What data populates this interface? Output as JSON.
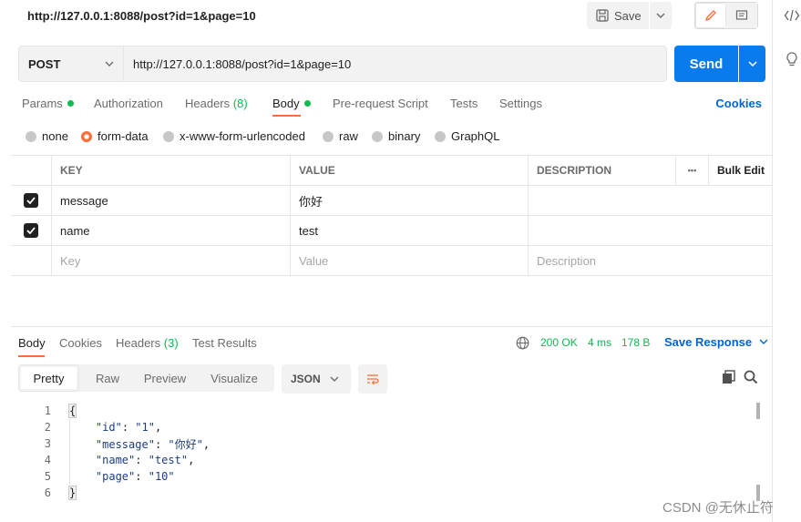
{
  "titlebar": {
    "tab_title": "http://127.0.0.1:8088/post?id=1&page=10",
    "save_label": "Save"
  },
  "request": {
    "method": "POST",
    "url": "http://127.0.0.1:8088/post?id=1&page=10",
    "send_label": "Send"
  },
  "request_tabs": {
    "params": "Params",
    "authorization": "Authorization",
    "headers": "Headers",
    "headers_count": "(8)",
    "body": "Body",
    "pre_request": "Pre-request Script",
    "tests": "Tests",
    "settings": "Settings",
    "cookies": "Cookies"
  },
  "body_types": {
    "none": "none",
    "form_data": "form-data",
    "urlencoded": "x-www-form-urlencoded",
    "raw": "raw",
    "binary": "binary",
    "graphql": "GraphQL",
    "selected": "form-data"
  },
  "params_table": {
    "headers": {
      "key": "KEY",
      "value": "VALUE",
      "description": "DESCRIPTION",
      "more": "•••",
      "bulk_edit": "Bulk Edit"
    },
    "rows": [
      {
        "key": "message",
        "value": "你好",
        "description": "",
        "checked": true
      },
      {
        "key": "name",
        "value": "test",
        "description": "",
        "checked": true
      }
    ],
    "placeholders": {
      "key": "Key",
      "value": "Value",
      "description": "Description"
    }
  },
  "response": {
    "tabs": {
      "body": "Body",
      "cookies": "Cookies",
      "headers": "Headers",
      "headers_count": "(3)",
      "test_results": "Test Results"
    },
    "status": "200 OK",
    "time": "4 ms",
    "size": "178 B",
    "save_response": "Save Response",
    "views": {
      "pretty": "Pretty",
      "raw": "Raw",
      "preview": "Preview",
      "visualize": "Visualize"
    },
    "format": "JSON",
    "line_numbers": [
      "1",
      "2",
      "3",
      "4",
      "5",
      "6"
    ],
    "lines": [
      {
        "brace": "{"
      },
      {
        "key": "\"id\"",
        "val": "\"1\"",
        "comma": ","
      },
      {
        "key": "\"message\"",
        "val": "\"你好\"",
        "comma": ","
      },
      {
        "key": "\"name\"",
        "val": "\"test\"",
        "comma": ","
      },
      {
        "key": "\"page\"",
        "val": "\"10\"",
        "comma": ""
      },
      {
        "brace": "}"
      }
    ]
  },
  "watermark": "CSDN @无休止符",
  "colors": {
    "accent_orange": "#ff6c37",
    "send_blue": "#097bed",
    "link_blue": "#0265d2",
    "success_green": "#0cbb52"
  }
}
